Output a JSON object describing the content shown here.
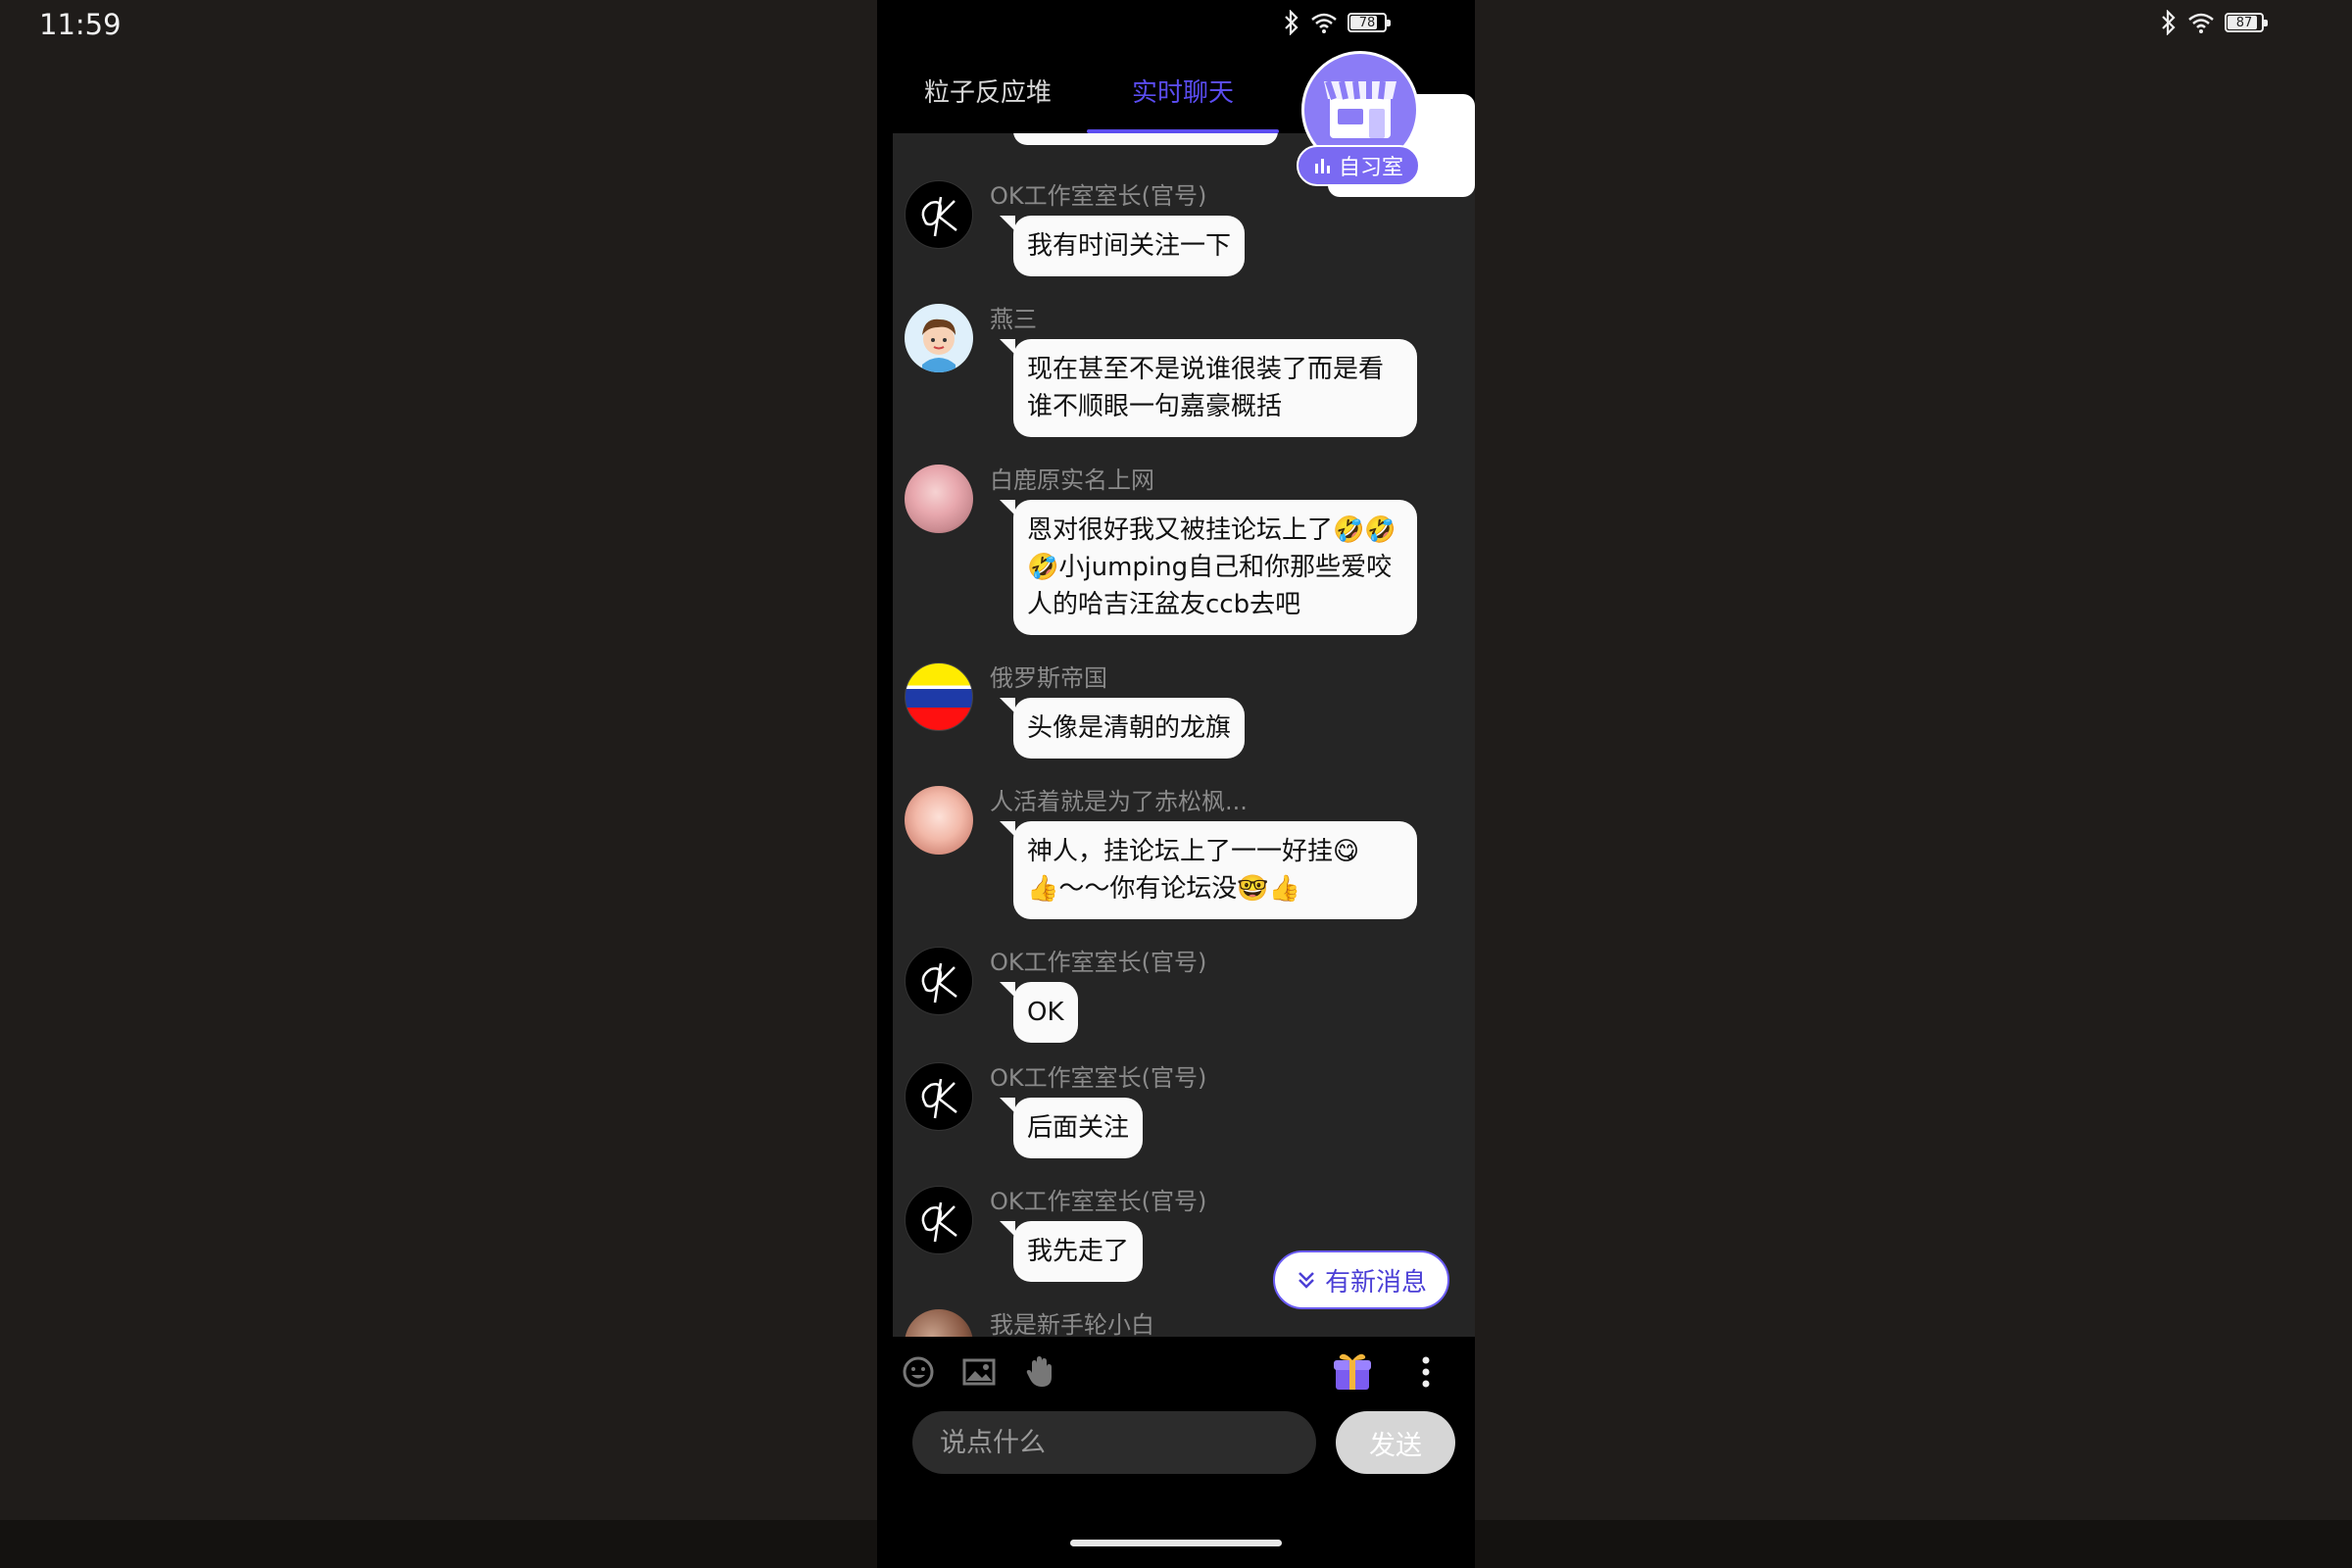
{
  "system": {
    "time": "11:59",
    "battery_phone": "78",
    "battery_tablet": "87"
  },
  "tabs": [
    {
      "label": "粒子反应堆",
      "active": false
    },
    {
      "label": "实时聊天",
      "active": true
    }
  ],
  "store_badge": {
    "icon_text": "自习",
    "label": "自习室"
  },
  "messages": [
    {
      "name": "OK工作室室长(官号)",
      "text": "我有时间关注一下",
      "avatar": "ok-logo"
    },
    {
      "name": "燕三",
      "text": "现在甚至不是说谁很装了而是看谁不顺眼一句嘉豪概括",
      "avatar": "cartoon-boy"
    },
    {
      "name": "白鹿原实名上网",
      "text": "恩对很好我又被挂论坛上了🤣🤣🤣小jumping自己和你那些爱咬人的哈吉汪盆友ccb去吧",
      "avatar": "anime-girl"
    },
    {
      "name": "俄罗斯帝国",
      "text": "头像是清朝的龙旗",
      "avatar": "flag"
    },
    {
      "name": "人活着就是为了赤松枫...",
      "text": "神人，挂论坛上了一一好挂😋👍〜〜你有论坛没🤓👍",
      "avatar": "anime-girl-2"
    },
    {
      "name": "OK工作室室长(官号)",
      "text": "OK",
      "avatar": "ok-logo"
    },
    {
      "name": "OK工作室室长(官号)",
      "text": "后面关注",
      "avatar": "ok-logo"
    },
    {
      "name": "OK工作室室长(官号)",
      "text": "我先走了",
      "avatar": "ok-logo"
    },
    {
      "name": "我是新手轮小白",
      "text": "",
      "avatar": "partial"
    }
  ],
  "new_messages_button": "有新消息",
  "toolbar": {
    "icons": [
      "emoji-icon",
      "image-icon",
      "hand-icon",
      "gift-icon",
      "more-icon"
    ]
  },
  "composer": {
    "placeholder": "说点什么",
    "send_label": "发送"
  }
}
